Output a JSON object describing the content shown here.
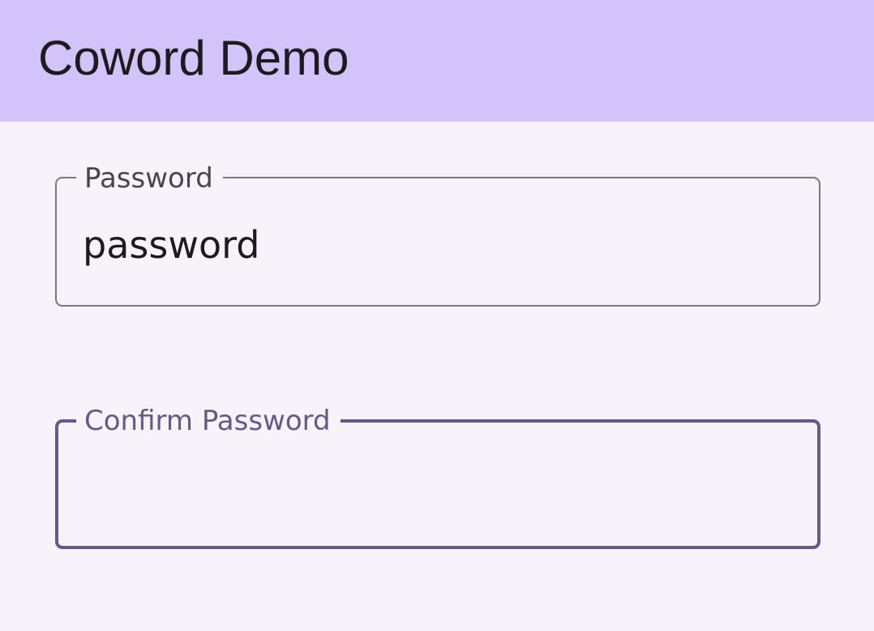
{
  "app_bar": {
    "title": "Coword Demo",
    "background_color": "#d2c3fa"
  },
  "form": {
    "password": {
      "label": "Password",
      "value": "password"
    },
    "confirm_password": {
      "label": "Confirm Password",
      "value": "",
      "focused": true,
      "accent_color": "#655a86"
    }
  }
}
